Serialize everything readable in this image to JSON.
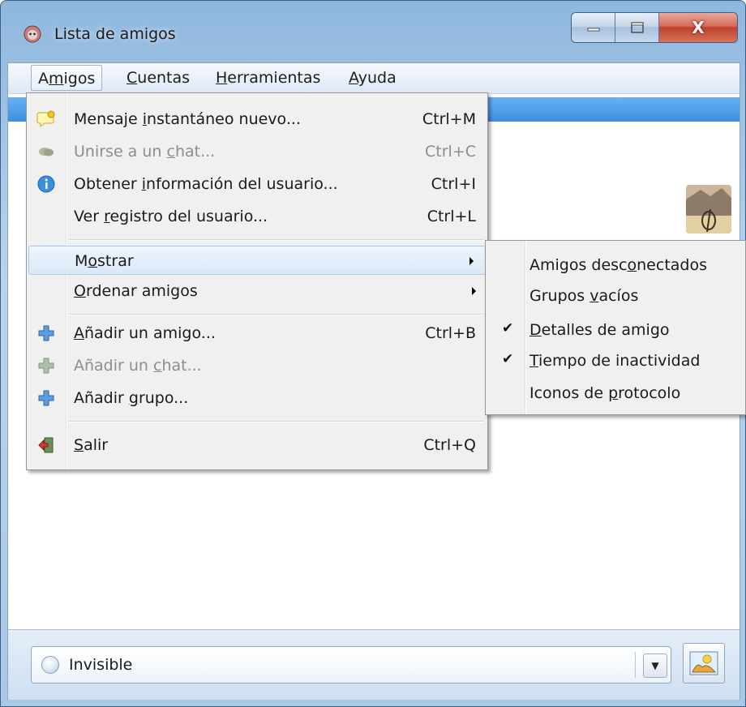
{
  "window": {
    "title": "Lista de amigos"
  },
  "menubar": [
    {
      "pre": "A",
      "u": "m",
      "post": "igos"
    },
    {
      "pre": "",
      "u": "C",
      "post": "uentas"
    },
    {
      "pre": "",
      "u": "H",
      "post": "erramientas"
    },
    {
      "pre": "",
      "u": "A",
      "post": "yuda"
    }
  ],
  "amigos_menu": {
    "items": [
      {
        "pre": "Mensaje ",
        "u": "i",
        "post": "nstantáneo nuevo...",
        "shortcut": "Ctrl+M",
        "icon": "new-message-icon",
        "enabled": true
      },
      {
        "pre": "Unirse a un ",
        "u": "c",
        "post": "hat...",
        "shortcut": "Ctrl+C",
        "icon": "join-chat-icon",
        "enabled": false
      },
      {
        "pre": "Obtener ",
        "u": "i",
        "post": "nformación del usuario...",
        "shortcut": "Ctrl+I",
        "icon": "info-icon",
        "enabled": true
      },
      {
        "pre": "Ver ",
        "u": "r",
        "post": "egistro del usuario...",
        "shortcut": "Ctrl+L",
        "icon": "",
        "enabled": true
      },
      {
        "pre": "M",
        "u": "o",
        "post": "strar",
        "shortcut": "",
        "submenu": true,
        "enabled": true
      },
      {
        "pre": "",
        "u": "O",
        "post": "rdenar amigos",
        "shortcut": "",
        "submenu": true,
        "enabled": true
      },
      {
        "pre": "",
        "u": "A",
        "post": "ñadir un amigo...",
        "shortcut": "Ctrl+B",
        "icon": "add-icon",
        "enabled": true
      },
      {
        "pre": "Añadir un ",
        "u": "c",
        "post": "hat...",
        "shortcut": "",
        "icon": "add-icon",
        "enabled": false
      },
      {
        "pre": "Añadir ",
        "u": "g",
        "post": "rupo...",
        "shortcut": "",
        "icon": "add-icon",
        "enabled": true
      },
      {
        "pre": "",
        "u": "S",
        "post": "alir",
        "shortcut": "Ctrl+Q",
        "icon": "exit-icon",
        "enabled": true
      }
    ]
  },
  "mostrar_submenu": {
    "items": [
      {
        "pre": "Amigos desc",
        "u": "o",
        "post": "nectados",
        "checked": false
      },
      {
        "pre": "Grupos ",
        "u": "v",
        "post": "acíos",
        "checked": false
      },
      {
        "pre": "",
        "u": "D",
        "post": "etalles de amigo",
        "checked": true
      },
      {
        "pre": "",
        "u": "T",
        "post": "iempo de inactividad",
        "checked": true
      },
      {
        "pre": "Iconos de ",
        "u": "p",
        "post": "rotocolo",
        "checked": false
      }
    ]
  },
  "status": {
    "text": "Invisible"
  },
  "icons": {
    "check": "✔",
    "close": "X",
    "dropdown": "▼"
  },
  "colors": {
    "selection": "#3e8fe0",
    "menu_bg": "#f0f0f0"
  }
}
